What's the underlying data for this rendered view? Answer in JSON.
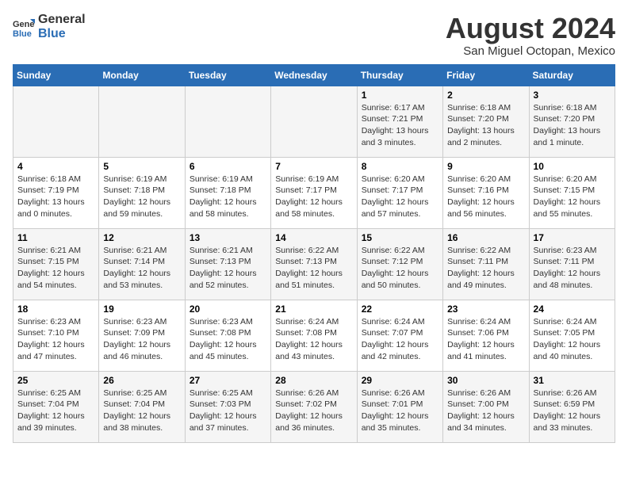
{
  "header": {
    "logo_general": "General",
    "logo_blue": "Blue",
    "title": "August 2024",
    "subtitle": "San Miguel Octopan, Mexico"
  },
  "days_of_week": [
    "Sunday",
    "Monday",
    "Tuesday",
    "Wednesday",
    "Thursday",
    "Friday",
    "Saturday"
  ],
  "weeks": [
    [
      {
        "day": "",
        "info": ""
      },
      {
        "day": "",
        "info": ""
      },
      {
        "day": "",
        "info": ""
      },
      {
        "day": "",
        "info": ""
      },
      {
        "day": "1",
        "info": "Sunrise: 6:17 AM\nSunset: 7:21 PM\nDaylight: 13 hours\nand 3 minutes."
      },
      {
        "day": "2",
        "info": "Sunrise: 6:18 AM\nSunset: 7:20 PM\nDaylight: 13 hours\nand 2 minutes."
      },
      {
        "day": "3",
        "info": "Sunrise: 6:18 AM\nSunset: 7:20 PM\nDaylight: 13 hours\nand 1 minute."
      }
    ],
    [
      {
        "day": "4",
        "info": "Sunrise: 6:18 AM\nSunset: 7:19 PM\nDaylight: 13 hours\nand 0 minutes."
      },
      {
        "day": "5",
        "info": "Sunrise: 6:19 AM\nSunset: 7:18 PM\nDaylight: 12 hours\nand 59 minutes."
      },
      {
        "day": "6",
        "info": "Sunrise: 6:19 AM\nSunset: 7:18 PM\nDaylight: 12 hours\nand 58 minutes."
      },
      {
        "day": "7",
        "info": "Sunrise: 6:19 AM\nSunset: 7:17 PM\nDaylight: 12 hours\nand 58 minutes."
      },
      {
        "day": "8",
        "info": "Sunrise: 6:20 AM\nSunset: 7:17 PM\nDaylight: 12 hours\nand 57 minutes."
      },
      {
        "day": "9",
        "info": "Sunrise: 6:20 AM\nSunset: 7:16 PM\nDaylight: 12 hours\nand 56 minutes."
      },
      {
        "day": "10",
        "info": "Sunrise: 6:20 AM\nSunset: 7:15 PM\nDaylight: 12 hours\nand 55 minutes."
      }
    ],
    [
      {
        "day": "11",
        "info": "Sunrise: 6:21 AM\nSunset: 7:15 PM\nDaylight: 12 hours\nand 54 minutes."
      },
      {
        "day": "12",
        "info": "Sunrise: 6:21 AM\nSunset: 7:14 PM\nDaylight: 12 hours\nand 53 minutes."
      },
      {
        "day": "13",
        "info": "Sunrise: 6:21 AM\nSunset: 7:13 PM\nDaylight: 12 hours\nand 52 minutes."
      },
      {
        "day": "14",
        "info": "Sunrise: 6:22 AM\nSunset: 7:13 PM\nDaylight: 12 hours\nand 51 minutes."
      },
      {
        "day": "15",
        "info": "Sunrise: 6:22 AM\nSunset: 7:12 PM\nDaylight: 12 hours\nand 50 minutes."
      },
      {
        "day": "16",
        "info": "Sunrise: 6:22 AM\nSunset: 7:11 PM\nDaylight: 12 hours\nand 49 minutes."
      },
      {
        "day": "17",
        "info": "Sunrise: 6:23 AM\nSunset: 7:11 PM\nDaylight: 12 hours\nand 48 minutes."
      }
    ],
    [
      {
        "day": "18",
        "info": "Sunrise: 6:23 AM\nSunset: 7:10 PM\nDaylight: 12 hours\nand 47 minutes."
      },
      {
        "day": "19",
        "info": "Sunrise: 6:23 AM\nSunset: 7:09 PM\nDaylight: 12 hours\nand 46 minutes."
      },
      {
        "day": "20",
        "info": "Sunrise: 6:23 AM\nSunset: 7:08 PM\nDaylight: 12 hours\nand 45 minutes."
      },
      {
        "day": "21",
        "info": "Sunrise: 6:24 AM\nSunset: 7:08 PM\nDaylight: 12 hours\nand 43 minutes."
      },
      {
        "day": "22",
        "info": "Sunrise: 6:24 AM\nSunset: 7:07 PM\nDaylight: 12 hours\nand 42 minutes."
      },
      {
        "day": "23",
        "info": "Sunrise: 6:24 AM\nSunset: 7:06 PM\nDaylight: 12 hours\nand 41 minutes."
      },
      {
        "day": "24",
        "info": "Sunrise: 6:24 AM\nSunset: 7:05 PM\nDaylight: 12 hours\nand 40 minutes."
      }
    ],
    [
      {
        "day": "25",
        "info": "Sunrise: 6:25 AM\nSunset: 7:04 PM\nDaylight: 12 hours\nand 39 minutes."
      },
      {
        "day": "26",
        "info": "Sunrise: 6:25 AM\nSunset: 7:04 PM\nDaylight: 12 hours\nand 38 minutes."
      },
      {
        "day": "27",
        "info": "Sunrise: 6:25 AM\nSunset: 7:03 PM\nDaylight: 12 hours\nand 37 minutes."
      },
      {
        "day": "28",
        "info": "Sunrise: 6:26 AM\nSunset: 7:02 PM\nDaylight: 12 hours\nand 36 minutes."
      },
      {
        "day": "29",
        "info": "Sunrise: 6:26 AM\nSunset: 7:01 PM\nDaylight: 12 hours\nand 35 minutes."
      },
      {
        "day": "30",
        "info": "Sunrise: 6:26 AM\nSunset: 7:00 PM\nDaylight: 12 hours\nand 34 minutes."
      },
      {
        "day": "31",
        "info": "Sunrise: 6:26 AM\nSunset: 6:59 PM\nDaylight: 12 hours\nand 33 minutes."
      }
    ]
  ]
}
